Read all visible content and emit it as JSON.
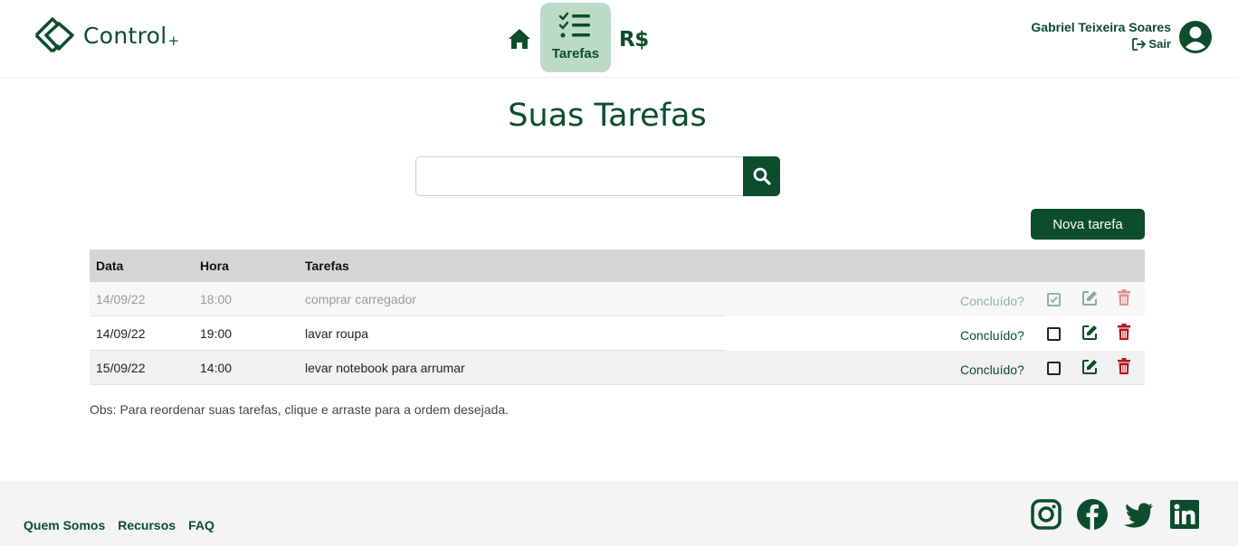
{
  "brand": {
    "name": "Control",
    "plus": "+"
  },
  "nav": {
    "tasks_label": "Tarefas",
    "money_label": "R$"
  },
  "user": {
    "name": "Gabriel Teixeira Soares",
    "logout_label": "Sair"
  },
  "main": {
    "title": "Suas Tarefas",
    "search": {
      "value": "",
      "placeholder": ""
    },
    "new_task_label": "Nova tarefa",
    "table": {
      "headers": {
        "date": "Data",
        "time": "Hora",
        "task": "Tarefas"
      },
      "rows": [
        {
          "date": "14/09/22",
          "time": "18:00",
          "task": "comprar carregador",
          "done_label": "Concluído?",
          "done": true
        },
        {
          "date": "14/09/22",
          "time": "19:00",
          "task": "lavar roupa",
          "done_label": "Concluído?",
          "done": false
        },
        {
          "date": "15/09/22",
          "time": "14:00",
          "task": "levar notebook para arrumar",
          "done_label": "Concluído?",
          "done": false
        }
      ]
    },
    "note": "Obs: Para reordenar suas tarefas, clique e arraste para a ordem desejada."
  },
  "footer": {
    "links": [
      "Quem Somos",
      "Recursos",
      "FAQ"
    ],
    "socials": [
      "instagram-icon",
      "facebook-icon",
      "twitter-icon",
      "linkedin-icon"
    ]
  },
  "colors": {
    "primary": "#0b4d2c",
    "active_nav": "#bcdac8",
    "delete": "#b3161b",
    "header_row": "#d5d5d5",
    "footer_bg": "#f4f4f4"
  }
}
